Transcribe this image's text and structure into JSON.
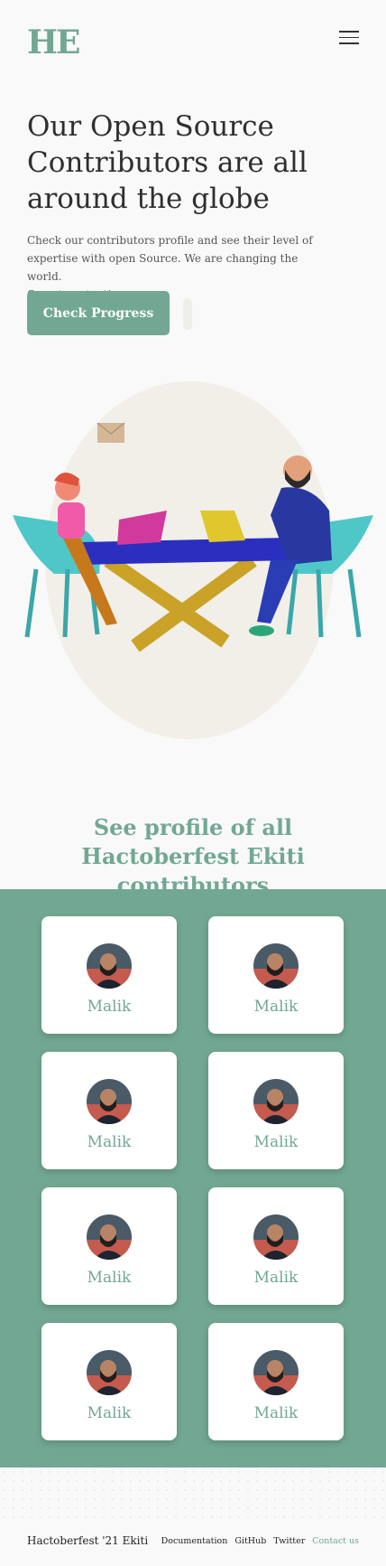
{
  "header": {
    "logo": "HE"
  },
  "hero": {
    "title": "Our Open Source Contributors are all around the globe",
    "subtitle": "Check our contributors profile and see their level of\n expertise with open Source. We are changing the world.\nOne step at a time.",
    "cta_label": "Check Progress"
  },
  "section": {
    "title": "See profile of all Hactoberfest Ekiti contributors"
  },
  "contributors": [
    {
      "name": "Malik"
    },
    {
      "name": "Malik"
    },
    {
      "name": "Malik"
    },
    {
      "name": "Malik"
    },
    {
      "name": "Malik"
    },
    {
      "name": "Malik"
    },
    {
      "name": "Malik"
    },
    {
      "name": "Malik"
    }
  ],
  "footer": {
    "brand": "Hactoberfest '21 Ekiti",
    "links": [
      "Documentation",
      "GitHub",
      "Twitter",
      "Contact us"
    ]
  },
  "colors": {
    "accent": "#72a893",
    "background": "#f9f9f9",
    "card": "#ffffff"
  },
  "icons": [
    "hamburger-menu-icon"
  ]
}
